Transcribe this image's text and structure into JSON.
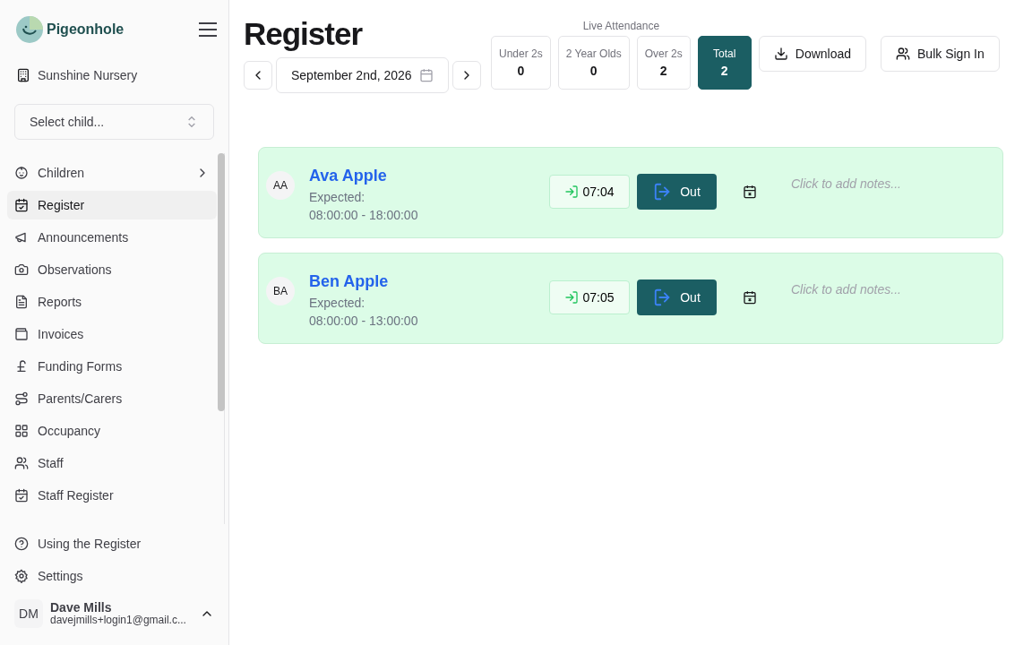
{
  "sidebar": {
    "brand": "Pigeonhole",
    "nursery": "Sunshine Nursery",
    "child_select": {
      "placeholder": "Select child..."
    },
    "items": [
      {
        "label": "Children",
        "selected": false,
        "has_submenu": true
      },
      {
        "label": "Register",
        "selected": true,
        "has_submenu": false
      },
      {
        "label": "Announcements",
        "selected": false,
        "has_submenu": false
      },
      {
        "label": "Observations",
        "selected": false,
        "has_submenu": false
      },
      {
        "label": "Reports",
        "selected": false,
        "has_submenu": false
      },
      {
        "label": "Invoices",
        "selected": false,
        "has_submenu": false
      },
      {
        "label": "Funding Forms",
        "selected": false,
        "has_submenu": false
      },
      {
        "label": "Parents/Carers",
        "selected": false,
        "has_submenu": false
      },
      {
        "label": "Occupancy",
        "selected": false,
        "has_submenu": false
      },
      {
        "label": "Staff",
        "selected": false,
        "has_submenu": false
      },
      {
        "label": "Staff Register",
        "selected": false,
        "has_submenu": false
      }
    ],
    "footer_items": [
      {
        "label": "Using the Register"
      },
      {
        "label": "Settings"
      }
    ],
    "user": {
      "initials": "DM",
      "name": "Dave Mills",
      "email": "davejmills+login1@gmail.c..."
    }
  },
  "header": {
    "title": "Register",
    "date": "September 2nd, 2026",
    "attendance_label": "Live Attendance",
    "stats": [
      {
        "label": "Under 2s",
        "value": "0",
        "selected": false
      },
      {
        "label": "2 Year Olds",
        "value": "0",
        "selected": false
      },
      {
        "label": "Over 2s",
        "value": "2",
        "selected": false
      },
      {
        "label": "Total",
        "value": "2",
        "selected": true
      }
    ],
    "buttons": [
      "Download",
      "Bulk Sign In"
    ]
  },
  "children": [
    {
      "initials": "AA",
      "name": "Ava Apple",
      "expected_label": "Expected:",
      "expected": "08:00:00 - 18:00:00",
      "in_time": "07:04",
      "out_label": "Out",
      "notes_placeholder": "Click to add notes..."
    },
    {
      "initials": "BA",
      "name": "Ben Apple",
      "expected_label": "Expected:",
      "expected": "08:00:00 - 13:00:00",
      "in_time": "07:05",
      "out_label": "Out",
      "notes_placeholder": "Click to add notes..."
    }
  ]
}
